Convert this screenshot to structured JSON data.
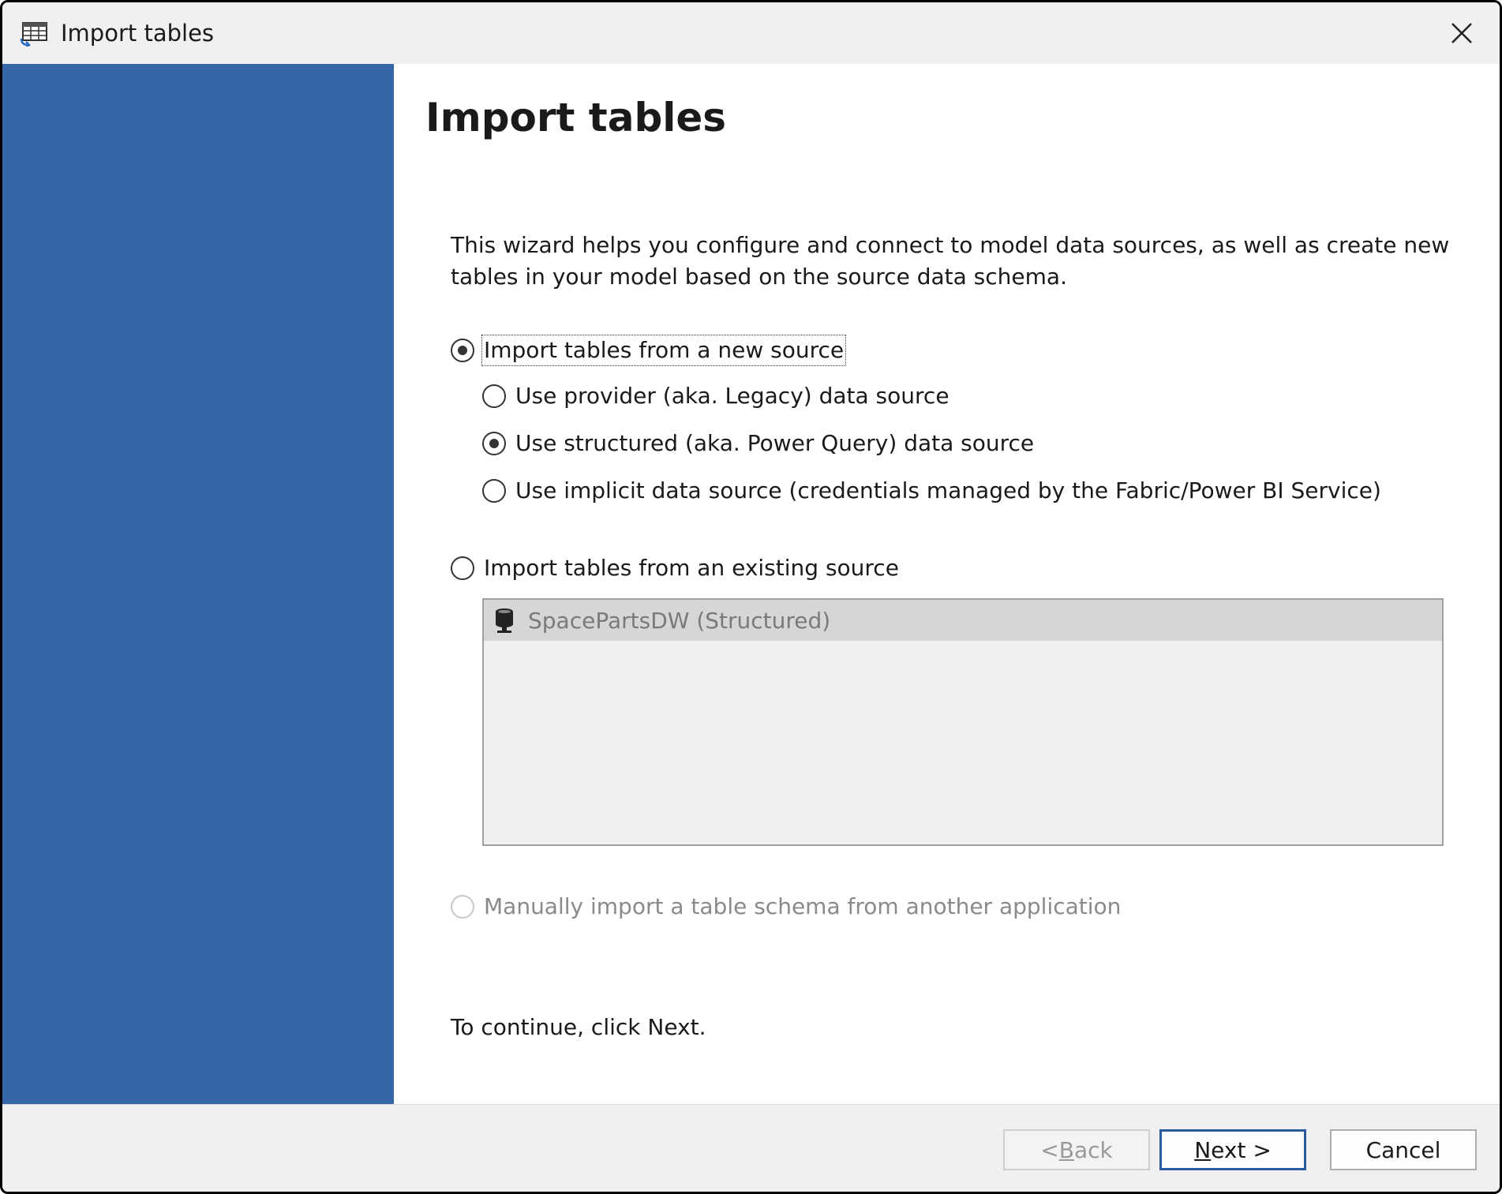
{
  "window": {
    "title": "Import tables"
  },
  "page": {
    "title": "Import tables",
    "intro": "This wizard helps you configure and connect to model data sources, as well as create new tables in your model based on the source data schema.",
    "continue_hint": "To continue, click Next."
  },
  "options": {
    "new_source": {
      "label": "Import tables from a new source",
      "checked": true
    },
    "provider": {
      "label": "Use provider (aka. Legacy) data source",
      "checked": false
    },
    "structured": {
      "label": "Use structured (aka. Power Query) data source",
      "checked": true
    },
    "implicit": {
      "label": "Use implicit data source (credentials managed by the Fabric/Power BI Service)",
      "checked": false
    },
    "existing_source": {
      "label": "Import tables from an existing source",
      "checked": false
    },
    "manual": {
      "label": "Manually import a table schema from another application",
      "checked": false,
      "disabled": true
    }
  },
  "existing_sources": [
    {
      "label": "SpacePartsDW (Structured)",
      "icon": "database-icon"
    }
  ],
  "buttons": {
    "back_prefix": "< ",
    "back_key": "B",
    "back_rest": "ack",
    "next_key": "N",
    "next_rest": "ext >",
    "cancel": "Cancel"
  },
  "colors": {
    "sidebar": "#3566a7",
    "primary_border": "#2a5a9f"
  }
}
